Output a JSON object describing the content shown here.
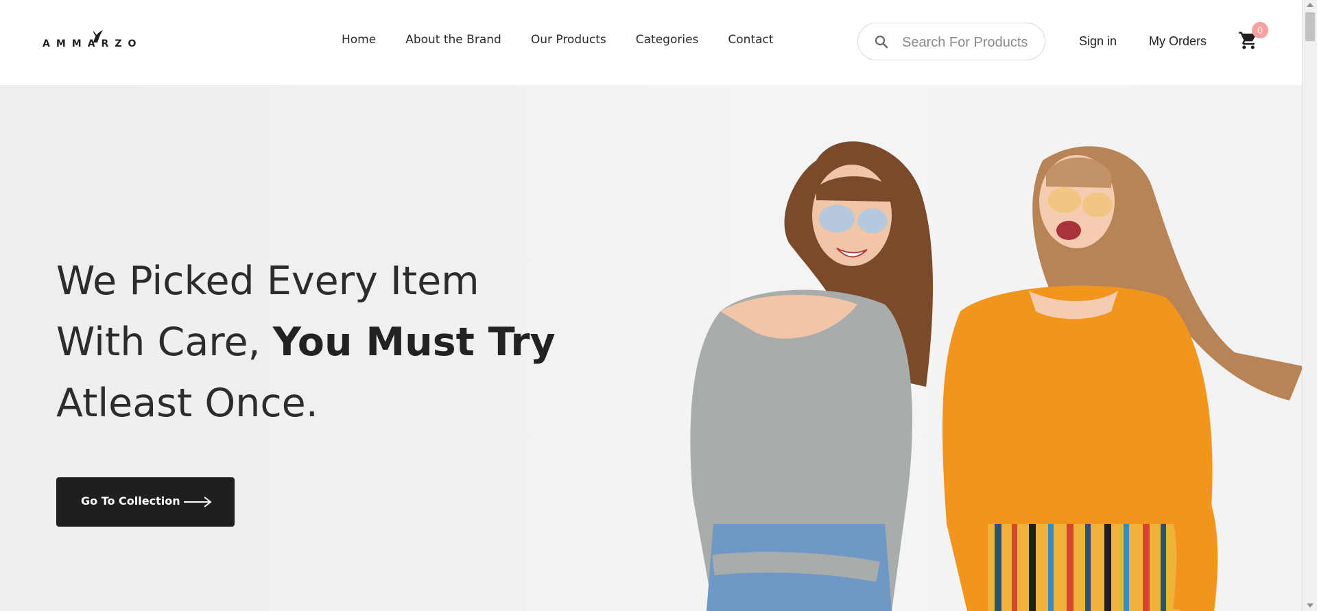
{
  "header": {
    "logo_text": "AMMARZO",
    "nav": [
      {
        "label": "Home"
      },
      {
        "label": "About the Brand"
      },
      {
        "label": "Our Products"
      },
      {
        "label": "Categories"
      },
      {
        "label": "Contact"
      }
    ],
    "search": {
      "placeholder": "Search For Products",
      "icon": "search-icon"
    },
    "signin_label": "Sign in",
    "orders_label": "My Orders",
    "cart": {
      "icon": "cart-icon",
      "count": "0"
    }
  },
  "hero": {
    "headline_line1": "We Picked Every Item",
    "headline_line2_plain": "With Care, ",
    "headline_line2_bold": "You Must Try",
    "headline_line3": "Atleast Once.",
    "cta_label": "Go To Collection",
    "cta_icon": "arrow-right-icon"
  },
  "colors": {
    "cta_bg": "#1f1f1f",
    "badge": "#f7a1a1",
    "sweater_grey": "#a8acab",
    "sweater_orange": "#f2951c"
  }
}
